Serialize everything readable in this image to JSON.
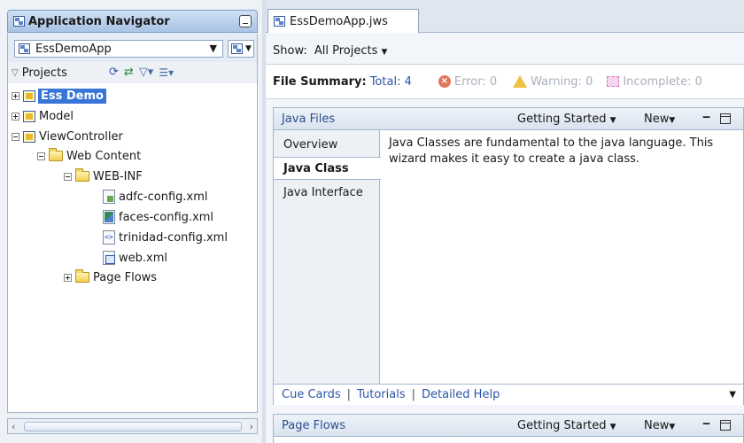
{
  "navigator": {
    "title": "Application Navigator",
    "app_name": "EssDemoApp",
    "projects_label": "Projects",
    "tree": [
      {
        "label": "Ess Demo",
        "selected": true
      },
      {
        "label": "Model"
      },
      {
        "label": "ViewController"
      },
      {
        "label": "Web Content"
      },
      {
        "label": "WEB-INF"
      },
      {
        "label": "adfc-config.xml"
      },
      {
        "label": "faces-config.xml"
      },
      {
        "label": "trinidad-config.xml"
      },
      {
        "label": "web.xml"
      },
      {
        "label": "Page Flows"
      }
    ]
  },
  "editor": {
    "tab_label": "EssDemoApp.jws",
    "show_label": "Show:",
    "show_value": "All Projects",
    "summary": {
      "title": "File Summary:",
      "total": "Total: 4",
      "error": "Error: 0",
      "warning": "Warning: 0",
      "incomplete": "Incomplete: 0"
    },
    "java_files": {
      "title": "Java Files",
      "getting_started": "Getting Started",
      "new_label": "New",
      "tabs": [
        "Overview",
        "Java Class",
        "Java Interface"
      ],
      "active_tab": "Java Class",
      "description": "Java Classes are fundamental to the java language. This wizard makes it easy to create a java class.",
      "links": [
        "Cue Cards",
        "Tutorials",
        "Detailed Help"
      ]
    },
    "page_flows": {
      "title": "Page Flows",
      "getting_started": "Getting Started",
      "new_label": "New"
    }
  }
}
